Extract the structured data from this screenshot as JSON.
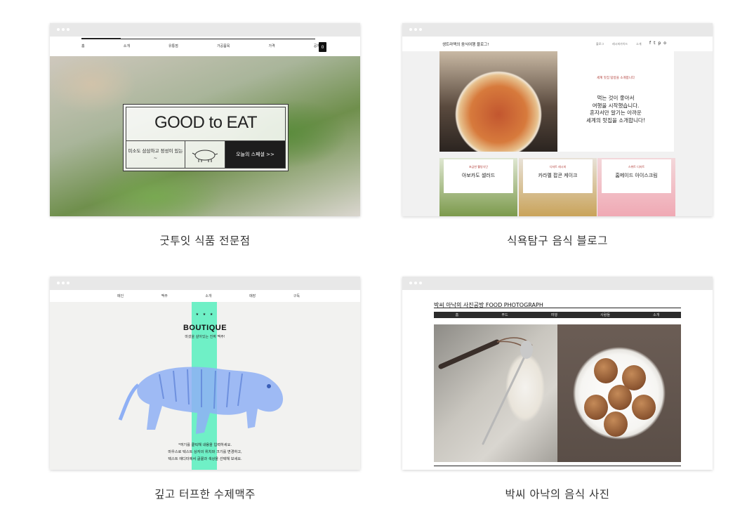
{
  "templates": [
    {
      "caption": "굿투잇 식품 전문점",
      "nav_items": [
        "홈",
        "소개",
        "유통점",
        "가공품목",
        "가격",
        "공지"
      ],
      "cart_count": "0",
      "hero_title": "GOOD to EAT",
      "box_text": "미소도 삼삼하고 정성이 있는~",
      "cta": "오늘의 스페셜 >>"
    },
    {
      "caption": "식욕탐구 음식 블로그",
      "logo": "생트라맥의 음식여행 블로그!",
      "nav_links": [
        "블로그",
        "레시피가이드",
        "소개"
      ],
      "social": [
        "f",
        "t",
        "p",
        "o"
      ],
      "kicker": "세계 맛집 탐방을 소개합니다",
      "body": [
        "먹는 것이 좋아서",
        "여행을 시작했습니다.",
        "혼자서만 알기는 아까운",
        "세계의 맛집을 소개합니다!"
      ],
      "tiles": [
        {
          "kicker": "초급한 웰빙식단",
          "title": "아보카도 샐러드"
        },
        {
          "kicker": "디저트 레시피",
          "title": "카라멜 팝콘 케이크"
        },
        {
          "kicker": "스위트 디저트",
          "title": "홈메이드 아이스크림"
        }
      ]
    },
    {
      "caption": "깊고 터프한 수제맥주",
      "nav_items": [
        "메인",
        "맥주",
        "소개",
        "매장",
        "구독"
      ],
      "stars": "★ ★ ★",
      "brand": "BOUTIQUE",
      "tagline": "마셨을 살아있는 진짜 맥주!",
      "footer": [
        "*여기를 클릭해 내용을 입력하세요.",
        "마우스로 텍스트 상자의 위치와 크기를 변경하고,",
        "텍스트 에디터에서 글꼴과 색상을 선택해 보세요."
      ]
    },
    {
      "caption": "박씨 아낙의 음식 사진",
      "site_title": "박씨 아낙의 사진공방 FOOD PHOTOGRAPH",
      "nav_items": [
        "홈",
        "푸드",
        "여행",
        "사람들",
        "소개"
      ]
    }
  ]
}
